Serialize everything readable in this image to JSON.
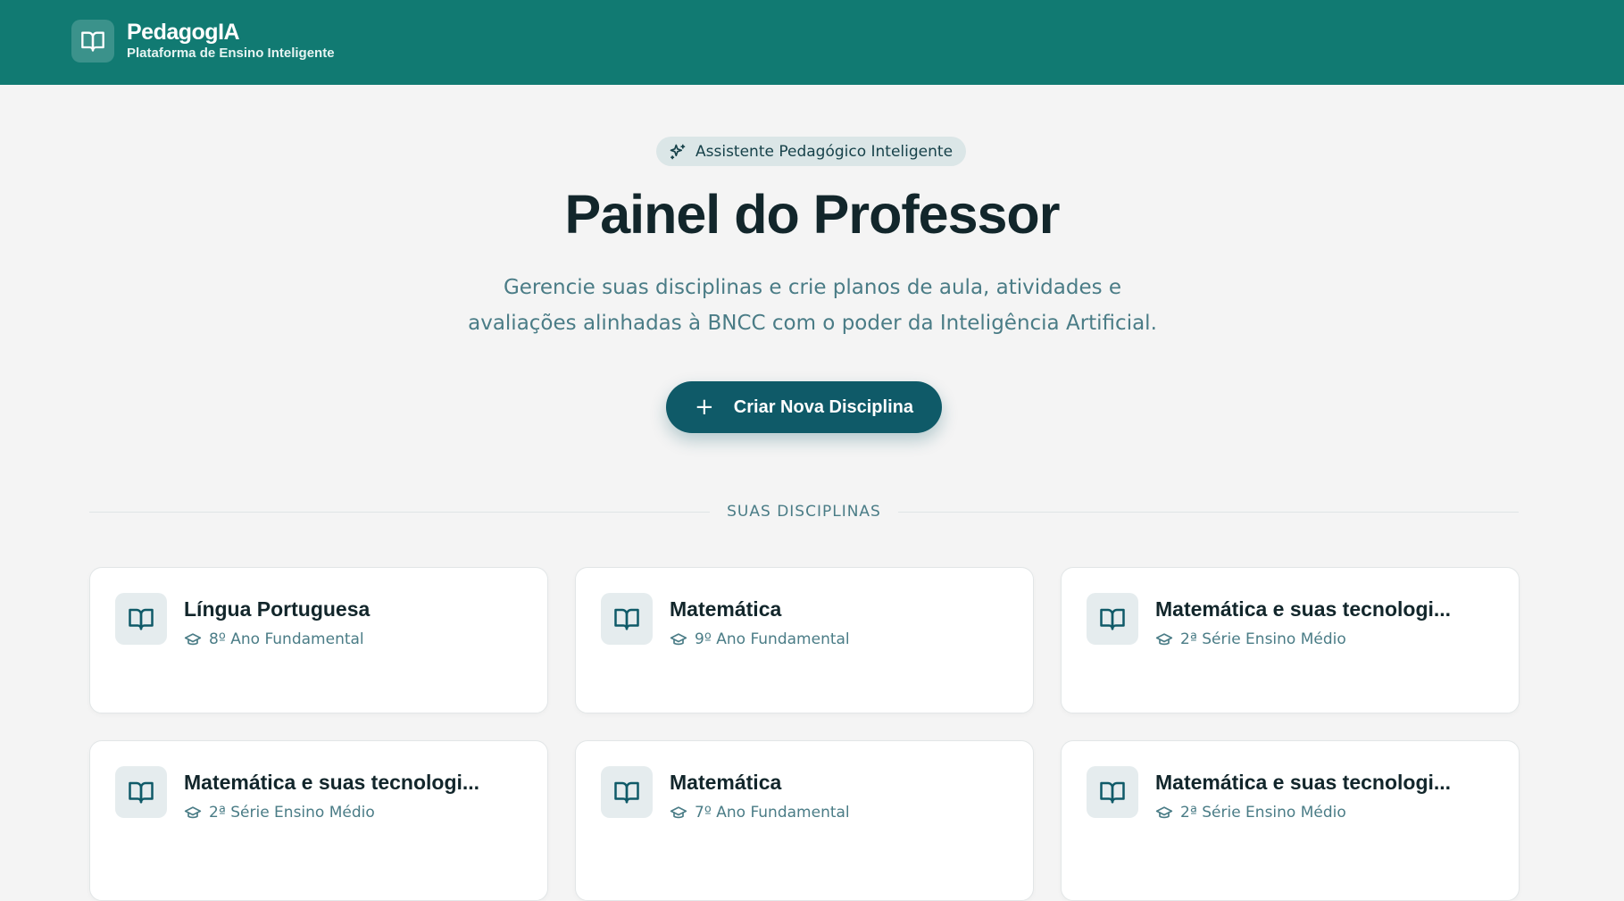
{
  "app": {
    "name": "PedagogIA",
    "tagline": "Plataforma de Ensino Inteligente",
    "logo_icon": "book-open-icon"
  },
  "hero": {
    "badge_label": "Assistente Pedagógico Inteligente",
    "badge_icon": "sparkles-icon",
    "title": "Painel do Professor",
    "subtitle_line1": "Gerencie suas disciplinas e crie planos de aula, atividades e",
    "subtitle_line2": "avaliações alinhadas à BNCC com o poder da Inteligência Artificial.",
    "cta_label": "Criar Nova Disciplina",
    "cta_icon": "plus-icon"
  },
  "section": {
    "label": "SUAS DISCIPLINAS"
  },
  "disciplines": [
    {
      "title": "Língua Portuguesa",
      "grade": "8º Ano Fundamental"
    },
    {
      "title": "Matemática",
      "grade": "9º Ano Fundamental"
    },
    {
      "title": "Matemática e suas tecnologi...",
      "grade": "2ª Série Ensino Médio"
    },
    {
      "title": "Matemática e suas tecnologi...",
      "grade": "2ª Série Ensino Médio"
    },
    {
      "title": "Matemática",
      "grade": "7º Ano Fundamental"
    },
    {
      "title": "Matemática e suas tecnologi...",
      "grade": "2ª Série Ensino Médio"
    }
  ],
  "colors": {
    "header_bg": "#117a72",
    "primary": "#0f5a68",
    "page_bg": "#f4f4f4",
    "muted_text": "#4a7c86"
  }
}
